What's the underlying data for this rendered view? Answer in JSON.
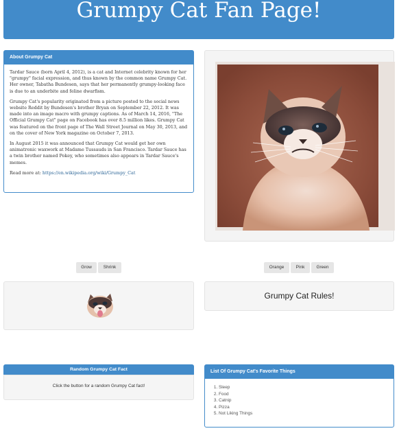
{
  "header": {
    "title": "Grumpy Cat Fan Page!"
  },
  "about": {
    "heading": "About Grumpy Cat",
    "paragraphs": [
      "Tardar Sauce (born April 4, 2012), is a cat and Internet celebrity known for her \"grumpy\" facial expression, and thus known by the common name Grumpy Cat. Her owner, Tabatha Bundesen, says that her permanently grumpy-looking face is due to an underbite and feline dwarfism.",
      "Grumpy Cat's popularity originated from a picture posted to the social news website Reddit by Bundesen's brother Bryan on September 22, 2012. It was made into an image macro with grumpy captions. As of March 14, 2016, \"The Official Grumpy Cat\" page on Facebook has over 8.5 million likes. Grumpy Cat was featured on the front page of The Wall Street Journal on May 30, 2013, and on the cover of New York magazine on October 7, 2013.",
      "In August 2015 it was announced that Grumpy Cat would get her own animatronic waxwork at Madame Tussauds in San Francisco. Tardar Sauce has a twin brother named Pokey, who sometimes also appears in Tardar Sauce's memes."
    ],
    "read_more_label": "Read more at: ",
    "read_more_link": "https://en.wikipedia.org/wiki/Grumpy_Cat"
  },
  "size_buttons": {
    "grow": "Grow",
    "shrink": "Shrink"
  },
  "color_buttons": {
    "orange": "Orange",
    "pink": "Pink",
    "green": "Green"
  },
  "rules_text": "Grumpy Cat Rules!",
  "fact": {
    "heading": "Random Grumpy Cat Fact",
    "body": "Click the button for a random Grumpy Cat fact!"
  },
  "favorites": {
    "heading": "List Of Grumpy Cat's Favorite Things",
    "items": [
      "Sleep",
      "Food",
      "Catnip",
      "Pizza",
      "Not Liking Things"
    ]
  },
  "colors": {
    "primary": "#428bca",
    "well": "#f5f5f5"
  }
}
